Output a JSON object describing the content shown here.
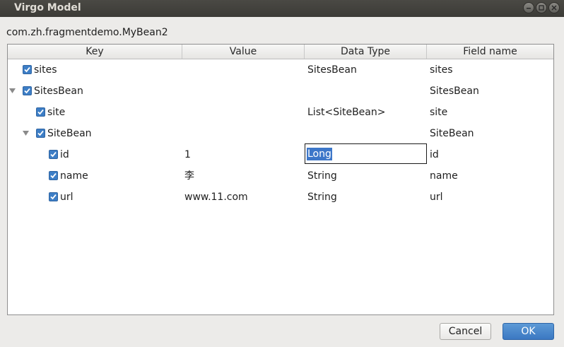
{
  "window": {
    "title": "Virgo Model"
  },
  "class_name": "com.zh.fragmentdemo.MyBean2",
  "table": {
    "columns": [
      "Key",
      "Value",
      "Data Type",
      "Field name"
    ],
    "rows": [
      {
        "key": "sites",
        "value": "",
        "data_type": "SitesBean",
        "field_name": "sites",
        "checked": true,
        "expandable": false
      },
      {
        "key": "SitesBean",
        "value": "",
        "data_type": "",
        "field_name": "SitesBean",
        "checked": true,
        "expandable": true,
        "expanded": true
      },
      {
        "key": "site",
        "value": "",
        "data_type": "List<SiteBean>",
        "field_name": "site",
        "checked": true,
        "expandable": false
      },
      {
        "key": "SiteBean",
        "value": "",
        "data_type": "",
        "field_name": "SiteBean",
        "checked": true,
        "expandable": true,
        "expanded": true
      },
      {
        "key": "id",
        "value": "1",
        "data_type": "Long",
        "field_name": "id",
        "checked": true,
        "expandable": false,
        "editing": true
      },
      {
        "key": "name",
        "value": "李",
        "data_type": "String",
        "field_name": "name",
        "checked": true,
        "expandable": false
      },
      {
        "key": "url",
        "value": "www.11.com",
        "data_type": "String",
        "field_name": "url",
        "checked": true,
        "expandable": false
      }
    ]
  },
  "buttons": {
    "cancel": "Cancel",
    "ok": "OK"
  },
  "colors": {
    "accent": "#3d7ec6",
    "titlebar": "#3c3b37",
    "selection": "#3d77c9"
  }
}
